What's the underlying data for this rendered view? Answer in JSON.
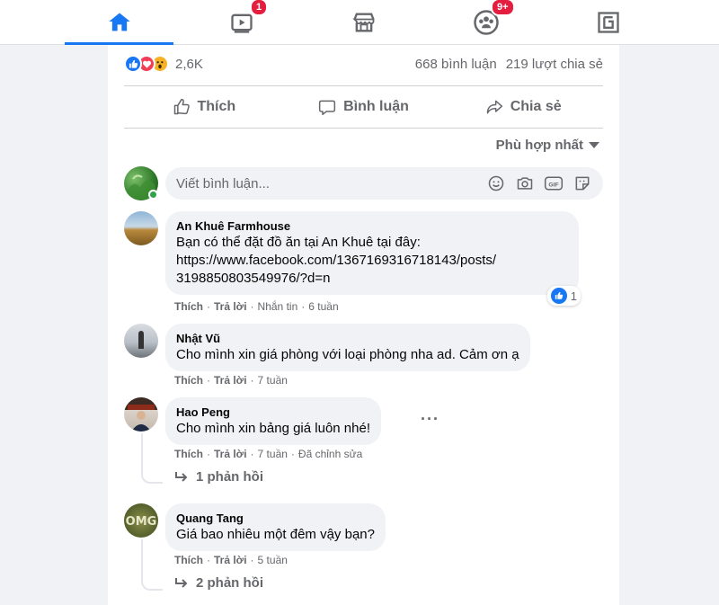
{
  "nav": {
    "tabs": [
      {
        "icon": "home-icon",
        "active": true
      },
      {
        "icon": "watch-icon",
        "badge": "1"
      },
      {
        "icon": "marketplace-icon"
      },
      {
        "icon": "groups-icon",
        "badge": "9+"
      },
      {
        "icon": "gaming-icon"
      }
    ]
  },
  "post": {
    "reaction_count": "2,6K",
    "comment_count": "668 bình luận",
    "share_count": "219 lượt chia sẻ",
    "actions": {
      "like": "Thích",
      "comment": "Bình luận",
      "share": "Chia sẻ"
    },
    "sort_label": "Phù hợp nhất",
    "composer_placeholder": "Viết bình luận..."
  },
  "comments": [
    {
      "author": "An Khuê Farmhouse",
      "lines": [
        "Bạn có thể đặt đồ ăn tại An Khuê tại đây:",
        "https://www.facebook.com/1367169316718143/posts/",
        "3198850803549976/?d=n"
      ],
      "like": "Thích",
      "reply": "Trả lời",
      "extra": "Nhắn tin",
      "time": "6 tuần",
      "like_count": "1"
    },
    {
      "author": "Nhật Vũ",
      "text": "Cho mình xin giá phòng với loại phòng nha ad. Cảm ơn ạ",
      "like": "Thích",
      "reply": "Trả lời",
      "time": "7 tuần"
    },
    {
      "author": "Hao Peng",
      "text": "Cho mình xin bảng giá luôn nhé!",
      "like": "Thích",
      "reply": "Trả lời",
      "time": "7 tuần",
      "edited": "Đã chỉnh sửa",
      "replies": "1 phản hồi"
    },
    {
      "author": "Quang Tang",
      "text": "Giá bao nhiêu một đêm vậy bạn?",
      "like": "Thích",
      "reply": "Trả lời",
      "time": "5 tuần",
      "replies": "2 phản hồi"
    }
  ],
  "colors": {
    "accent": "#1877f2",
    "badge": "#e41e3f",
    "online": "#31a24c",
    "secondary_text": "#65676b"
  }
}
